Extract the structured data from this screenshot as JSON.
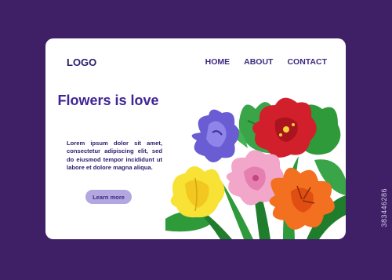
{
  "header": {
    "logo": "LOGO",
    "nav": [
      {
        "label": "HOME"
      },
      {
        "label": "ABOUT"
      },
      {
        "label": "CONTACT"
      }
    ]
  },
  "hero": {
    "headline": "Flowers is love",
    "body": "Lorem ipsum dolor sit amet, consectetur adipiscing elit, sed do eiusmod tempor incididunt ut labore et dolore magna aliqua.",
    "cta_label": "Learn more"
  },
  "watermark": {
    "id": "383446286"
  },
  "colors": {
    "background": "#3f1f66",
    "card": "#ffffff",
    "accent": "#3f2496",
    "button": "#b4a6e0"
  }
}
